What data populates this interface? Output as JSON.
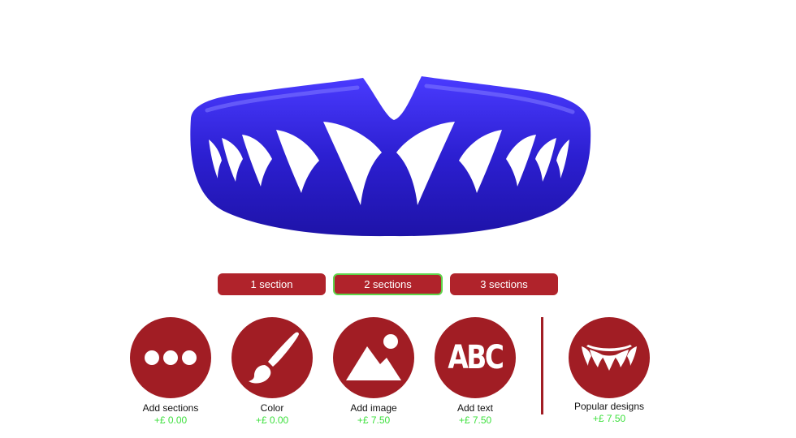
{
  "colors": {
    "brand_red": "#a11d24",
    "button_red": "#b0232b",
    "selected_outline": "#5fd44a",
    "price_green": "#3ee03e",
    "guard_blue": "#2c1fd1",
    "fang_white": "#ffffff"
  },
  "preview": {
    "object": "mouthguard",
    "color_name": "blue",
    "pattern": "white-fangs",
    "icon": "mouthguard-fangs-preview"
  },
  "sections": {
    "options": [
      {
        "label": "1 section",
        "selected": false
      },
      {
        "label": "2 sections",
        "selected": true
      },
      {
        "label": "3 sections",
        "selected": false
      }
    ]
  },
  "tools": [
    {
      "label": "Add sections",
      "price": "+£ 0.00",
      "icon": "three-dots-icon"
    },
    {
      "label": "Color",
      "price": "+£ 0.00",
      "icon": "paintbrush-icon"
    },
    {
      "label": "Add image",
      "price": "+£ 7.50",
      "icon": "mountain-image-icon"
    },
    {
      "label": "Add text",
      "price": "+£ 7.50",
      "icon": "abc-text-icon",
      "icon_text": "ABC"
    },
    {
      "label": "Popular designs",
      "price": "+£ 7.50",
      "icon": "fangs-design-icon"
    }
  ]
}
